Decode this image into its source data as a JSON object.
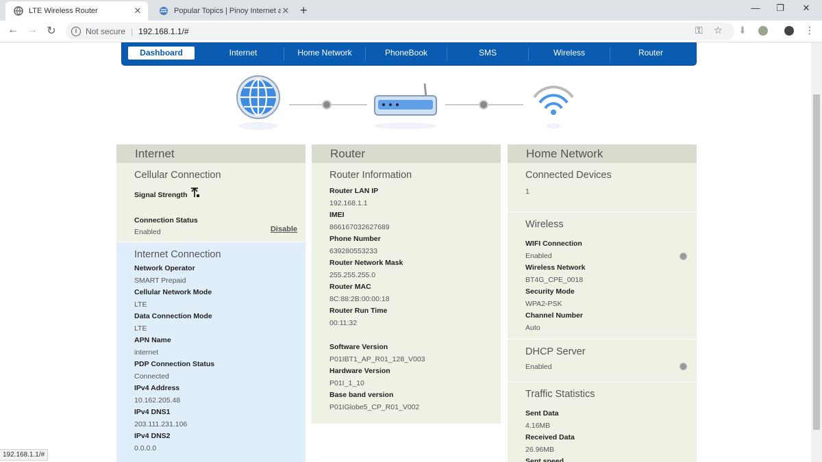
{
  "tabs": [
    {
      "title": "LTE Wireless Router",
      "active": true
    },
    {
      "title": "Popular Topics | Pinoy Internet and",
      "active": false
    }
  ],
  "address": {
    "security": "Not secure",
    "url": "192.168.1.1/#"
  },
  "nav": [
    "Dashboard",
    "Internet",
    "Home Network",
    "PhoneBook",
    "SMS",
    "Wireless",
    "Router"
  ],
  "internet": {
    "heading": "Internet",
    "cellular": {
      "title": "Cellular Connection",
      "signal_label": "Signal Strength",
      "status_label": "Connection Status",
      "status_value": "Enabled",
      "disable_link": "Disable"
    },
    "connection": {
      "title": "Internet Connection",
      "fields": [
        {
          "label": "Network Operator",
          "value": "SMART Prepaid"
        },
        {
          "label": "Cellular Network Mode",
          "value": "LTE"
        },
        {
          "label": "Data Connection Mode",
          "value": "LTE"
        },
        {
          "label": "APN Name",
          "value": "internet"
        },
        {
          "label": "PDP Connection Status",
          "value": "Connected"
        },
        {
          "label": "IPv4 Address",
          "value": "10.162.205.48"
        },
        {
          "label": "IPv4 DNS1",
          "value": "203.111.231.106"
        },
        {
          "label": "IPv4 DNS2",
          "value": "0.0.0.0"
        }
      ]
    }
  },
  "router": {
    "heading": "Router",
    "info": {
      "title": "Router Information",
      "fields": [
        {
          "label": "Router LAN IP",
          "value": "192.168.1.1"
        },
        {
          "label": "IMEI",
          "value": "866167032627689"
        },
        {
          "label": "Phone Number",
          "value": "639280553233"
        },
        {
          "label": "Router Network Mask",
          "value": "255.255.255.0"
        },
        {
          "label": "Router MAC",
          "value": "8C:88:2B:00:00:18"
        },
        {
          "label": "Router Run Time",
          "value": "00:11:32"
        }
      ],
      "fields2": [
        {
          "label": "Software Version",
          "value": "P01IBT1_AP_R01_128_V003"
        },
        {
          "label": "Hardware Version",
          "value": "P01I_1_10"
        },
        {
          "label": "Base band version",
          "value": "P01IGlobe5_CP_R01_V002"
        }
      ]
    }
  },
  "home": {
    "heading": "Home Network",
    "devices": {
      "title": "Connected Devices",
      "value": "1"
    },
    "wireless": {
      "title": "Wireless",
      "fields": [
        {
          "label": "WIFI Connection",
          "value": "Enabled"
        },
        {
          "label": "Wireless Network",
          "value": "BT4G_CPE_0018"
        },
        {
          "label": "Security Mode",
          "value": "WPA2-PSK"
        },
        {
          "label": "Channel Number",
          "value": "Auto"
        }
      ]
    },
    "dhcp": {
      "title": "DHCP Server",
      "value": "Enabled"
    },
    "traffic": {
      "title": "Traffic Statistics",
      "fields": [
        {
          "label": "Sent Data",
          "value": "4.16MB"
        },
        {
          "label": "Received Data",
          "value": "26.96MB"
        },
        {
          "label": "Sent speed",
          "value": ""
        }
      ]
    }
  },
  "status_url": "192.168.1.1/#",
  "colors": {
    "nav_blue": "#0a5cb3",
    "section_green": "#eef2e4",
    "section_blue": "#e0eefa",
    "header_gray": "#d8dccf"
  }
}
